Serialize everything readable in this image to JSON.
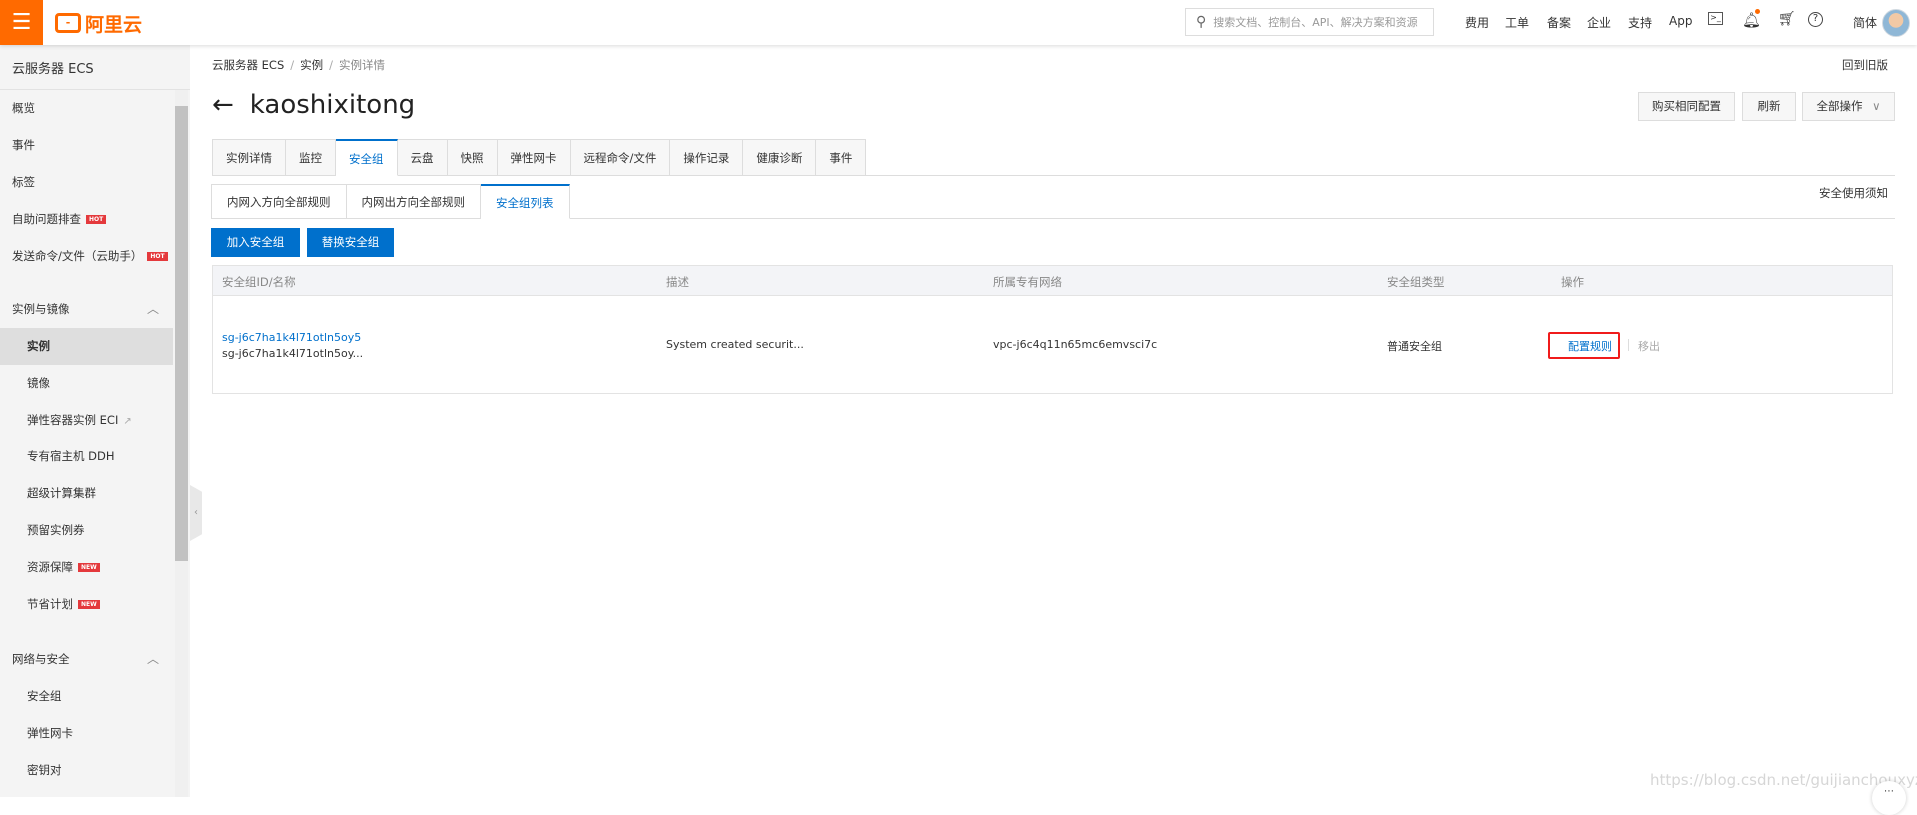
{
  "header": {
    "logo": "阿里云",
    "search_placeholder": "搜索文档、控制台、API、解决方案和资源",
    "nav": [
      "费用",
      "工单",
      "备案",
      "企业",
      "支持",
      "App"
    ],
    "lang": "简体",
    "accent": "#ff6a00"
  },
  "sidebar": {
    "title": "云服务器 ECS",
    "top_items": [
      {
        "label": "概览"
      },
      {
        "label": "事件"
      },
      {
        "label": "标签"
      },
      {
        "label": "自助问题排查",
        "badge": "HOT"
      },
      {
        "label": "发送命令/文件（云助手）",
        "badge": "HOT"
      }
    ],
    "groups": [
      {
        "label": "实例与镜像",
        "items": [
          {
            "label": "实例",
            "active": true
          },
          {
            "label": "镜像"
          },
          {
            "label": "弹性容器实例 ECI"
          },
          {
            "label": "专有宿主机 DDH"
          },
          {
            "label": "超级计算集群"
          },
          {
            "label": "预留实例券"
          },
          {
            "label": "资源保障",
            "badge": "NEW"
          },
          {
            "label": "节省计划",
            "badge": "NEW"
          }
        ]
      },
      {
        "label": "网络与安全",
        "items": [
          {
            "label": "安全组"
          },
          {
            "label": "弹性网卡"
          },
          {
            "label": "密钥对"
          }
        ]
      }
    ]
  },
  "breadcrumb": [
    "云服务器 ECS",
    "实例",
    "实例详情"
  ],
  "old_version": "回到旧版",
  "page_title": "kaoshixitong",
  "actions": {
    "buy_same": "购买相同配置",
    "refresh": "刷新",
    "all_ops": "全部操作"
  },
  "tabs": [
    "实例详情",
    "监控",
    "安全组",
    "云盘",
    "快照",
    "弹性网卡",
    "远程命令/文件",
    "操作记录",
    "健康诊断",
    "事件"
  ],
  "active_tab": "安全组",
  "subtabs": [
    "内网入方向全部规则",
    "内网出方向全部规则",
    "安全组列表"
  ],
  "security_notice": "安全使用须知",
  "buttons": {
    "join": "加入安全组",
    "replace": "替换安全组"
  },
  "table": {
    "columns": [
      "安全组ID/名称",
      "描述",
      "所属专有网络",
      "安全组类型",
      "操作"
    ],
    "rows": [
      {
        "id": "sg-j6c7ha1k4l71otln5oy5",
        "name": "sg-j6c7ha1k4l71otln5oy...",
        "desc": "System created securit...",
        "vpc": "vpc-j6c4q11n65mc6emvsci7c",
        "type": "普通安全组",
        "op_config": "配置规则",
        "op_remove": "移出"
      }
    ]
  },
  "watermark": "https://blog.csdn.net/guijianchouxyz"
}
